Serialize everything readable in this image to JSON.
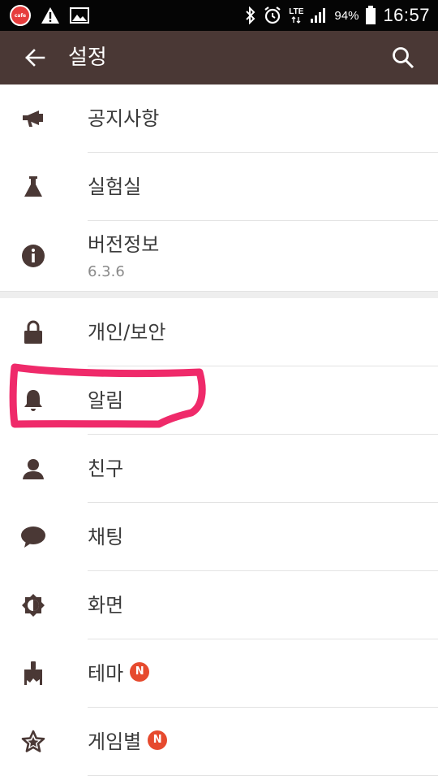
{
  "status_bar": {
    "app_badge_label": "cafe",
    "battery": "94%",
    "network": "LTE",
    "time": "16:57"
  },
  "app_bar": {
    "title": "설정"
  },
  "section1": [
    {
      "id": "notice",
      "label": "공지사항",
      "icon": "megaphone-icon"
    },
    {
      "id": "lab",
      "label": "실험실",
      "icon": "flask-icon"
    },
    {
      "id": "version",
      "label": "버전정보",
      "sub": "6.3.6",
      "icon": "info-icon"
    }
  ],
  "section2": [
    {
      "id": "privacy",
      "label": "개인/보안",
      "icon": "lock-icon"
    },
    {
      "id": "notifications",
      "label": "알림",
      "icon": "bell-icon"
    },
    {
      "id": "friends",
      "label": "친구",
      "icon": "person-icon"
    },
    {
      "id": "chat",
      "label": "채팅",
      "icon": "chat-bubble-icon"
    },
    {
      "id": "display",
      "label": "화면",
      "icon": "brightness-icon"
    },
    {
      "id": "theme",
      "label": "테마",
      "badge": "N",
      "icon": "paint-brush-icon"
    },
    {
      "id": "games",
      "label": "게임별",
      "badge": "N",
      "icon": "star-icon"
    }
  ],
  "colors": {
    "app_bar": "#4a3835",
    "icon": "#4a3835",
    "badge": "#e64a2e",
    "highlight_annotation": "#ef2a6a"
  }
}
